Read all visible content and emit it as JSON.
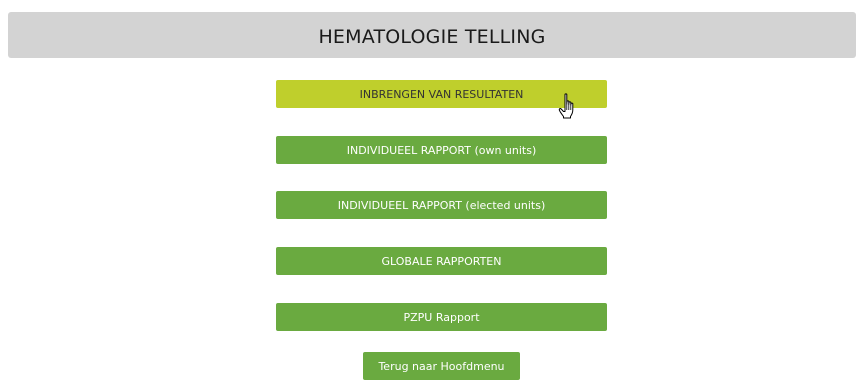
{
  "header": {
    "title": "HEMATOLOGIE TELLING"
  },
  "menu": {
    "items": [
      {
        "label": "INBRENGEN VAN RESULTATEN",
        "state": "hover"
      },
      {
        "label": "INDIVIDUEEL RAPPORT (own units)",
        "state": "normal"
      },
      {
        "label": "INDIVIDUEEL RAPPORT (elected units)",
        "state": "normal"
      },
      {
        "label": "GLOBALE RAPPORTEN",
        "state": "normal"
      },
      {
        "label": "PZPU Rapport",
        "state": "normal"
      }
    ],
    "back_label": "Terug naar Hoofdmenu"
  },
  "colors": {
    "header_bg": "#d3d3d3",
    "button_green": "#6aaa40",
    "button_hover": "#bfcf2c"
  },
  "icons": {
    "pointer": "hand-pointer-icon"
  }
}
